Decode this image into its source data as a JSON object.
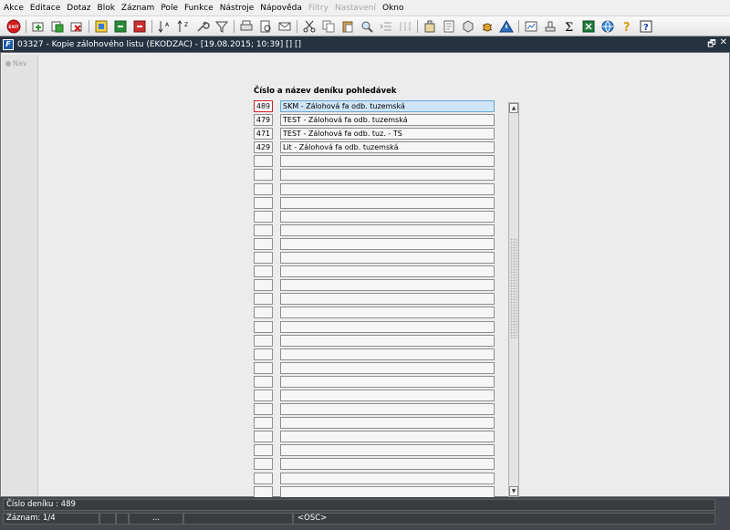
{
  "menu": [
    {
      "label": "Akce",
      "disabled": false
    },
    {
      "label": "Editace",
      "disabled": false
    },
    {
      "label": "Dotaz",
      "disabled": false
    },
    {
      "label": "Blok",
      "disabled": false
    },
    {
      "label": "Záznam",
      "disabled": false
    },
    {
      "label": "Pole",
      "disabled": false
    },
    {
      "label": "Funkce",
      "disabled": false
    },
    {
      "label": "Nástroje",
      "disabled": false
    },
    {
      "label": "Nápověda",
      "disabled": false
    },
    {
      "label": "Filtry",
      "disabled": true
    },
    {
      "label": "Nastavení",
      "disabled": true
    },
    {
      "label": "Okno",
      "disabled": false
    }
  ],
  "toolbar": {
    "exit_label": "EXIT"
  },
  "window": {
    "title": "03327 - Kopie zálohového listu (EKODZAC) - [19.08.2015; 10:39] [] []",
    "icon_letter": "F",
    "ctrl_restore": "🗗",
    "ctrl_close": "✕"
  },
  "nav": {
    "label": "Nav"
  },
  "grid": {
    "title": "Číslo a název deníku pohledávek",
    "rows": [
      {
        "code": "489",
        "name": "SKM - Zálohová fa odb. tuzemská",
        "selected": true
      },
      {
        "code": "479",
        "name": "TEST - Zálohová fa odb. tuzemská",
        "selected": false
      },
      {
        "code": "471",
        "name": "TEST - Zálohová fa odb. tuz. - TS",
        "selected": false
      },
      {
        "code": "429",
        "name": "Lit - Zálohová fa odb. tuzemská",
        "selected": false
      },
      {
        "code": "",
        "name": "",
        "selected": false
      },
      {
        "code": "",
        "name": "",
        "selected": false
      },
      {
        "code": "",
        "name": "",
        "selected": false
      },
      {
        "code": "",
        "name": "",
        "selected": false
      },
      {
        "code": "",
        "name": "",
        "selected": false
      },
      {
        "code": "",
        "name": "",
        "selected": false
      },
      {
        "code": "",
        "name": "",
        "selected": false
      },
      {
        "code": "",
        "name": "",
        "selected": false
      },
      {
        "code": "",
        "name": "",
        "selected": false
      },
      {
        "code": "",
        "name": "",
        "selected": false
      },
      {
        "code": "",
        "name": "",
        "selected": false
      },
      {
        "code": "",
        "name": "",
        "selected": false
      },
      {
        "code": "",
        "name": "",
        "selected": false
      },
      {
        "code": "",
        "name": "",
        "selected": false
      },
      {
        "code": "",
        "name": "",
        "selected": false
      },
      {
        "code": "",
        "name": "",
        "selected": false
      },
      {
        "code": "",
        "name": "",
        "selected": false
      },
      {
        "code": "",
        "name": "",
        "selected": false
      },
      {
        "code": "",
        "name": "",
        "selected": false
      },
      {
        "code": "",
        "name": "",
        "selected": false
      },
      {
        "code": "",
        "name": "",
        "selected": false
      },
      {
        "code": "",
        "name": "",
        "selected": false
      },
      {
        "code": "",
        "name": "",
        "selected": false
      },
      {
        "code": "",
        "name": "",
        "selected": false
      },
      {
        "code": "",
        "name": "",
        "selected": false
      }
    ]
  },
  "status": {
    "field_hint": "Číslo deníku : 489",
    "record": "Záznam: 1/4",
    "ellipsis": "...",
    "mode": "<OSC>"
  }
}
